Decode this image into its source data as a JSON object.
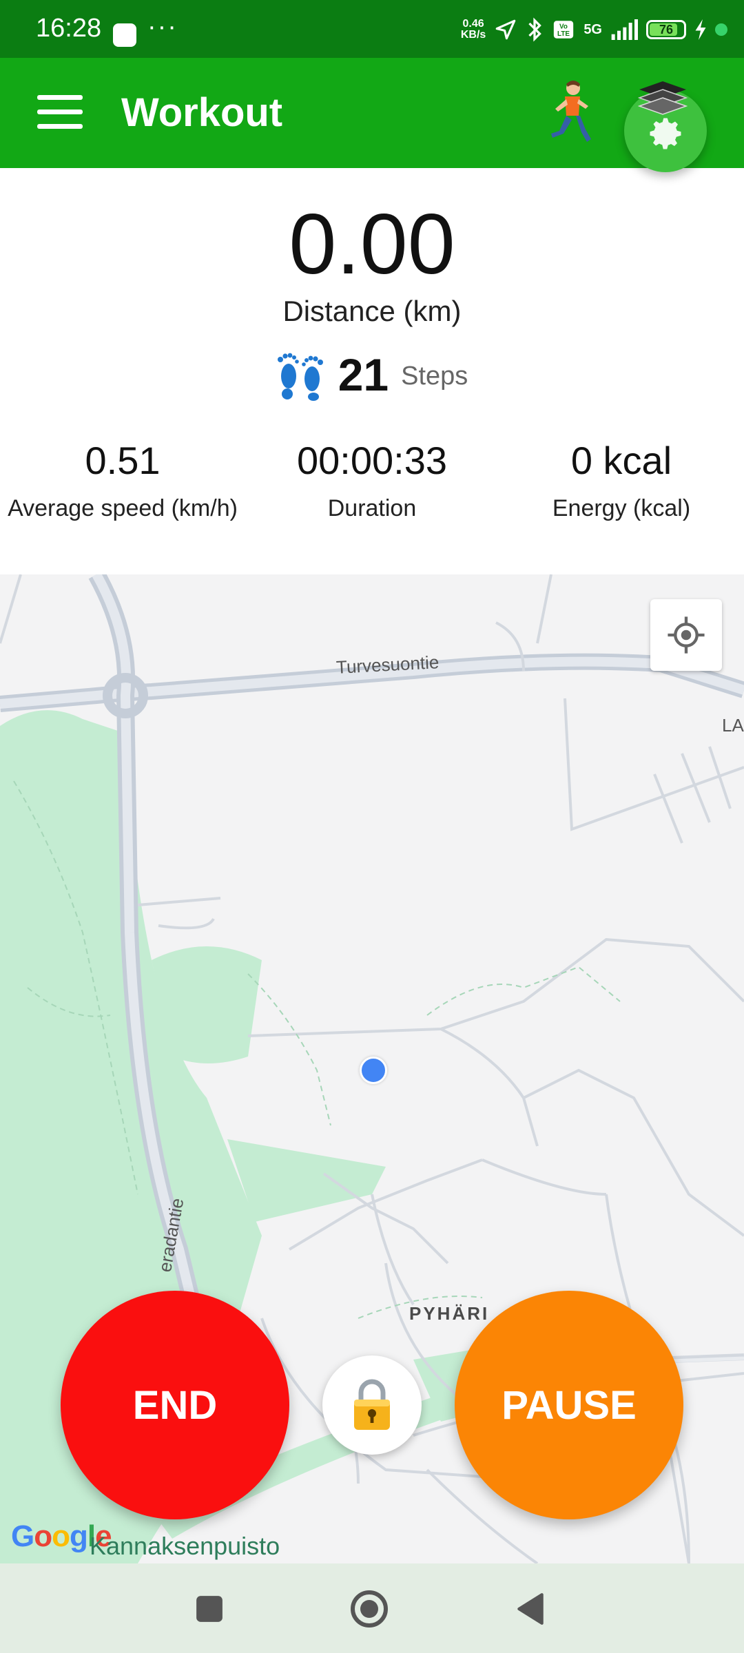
{
  "status_bar": {
    "time": "16:28",
    "more": "···",
    "net_speed_value": "0.46",
    "net_speed_unit": "KB/s",
    "network": "5G",
    "battery": "76"
  },
  "app_bar": {
    "title": "Workout",
    "color": "#12a815"
  },
  "stats": {
    "distance_value": "0.00",
    "distance_label": "Distance (km)",
    "steps_count": "21",
    "steps_label": "Steps",
    "metrics": [
      {
        "value": "0.51",
        "label": "Average speed (km/h)"
      },
      {
        "value": "00:00:33",
        "label": "Duration"
      },
      {
        "value": "0 kcal",
        "label": "Energy (kcal)"
      }
    ]
  },
  "map": {
    "labels": {
      "road_top": "Turvesuontie",
      "edge": "LA",
      "road_vertical": "eradantie",
      "district": "PYHÄRI"
    },
    "attribution": "Kannaksenpuisto",
    "logo": {
      "G": "G",
      "o1": "o",
      "o2": "o",
      "g": "g",
      "l": "l",
      "e": "e"
    }
  },
  "controls": {
    "end_label": "END",
    "pause_label": "PAUSE",
    "end_color": "#fa0f0f",
    "pause_color": "#fb8505"
  },
  "icons": {
    "menu": "hamburger-icon",
    "runner": "runner-icon",
    "settings": "gear-icon",
    "layers": "layers-icon",
    "footprints": "footprints-icon",
    "locate": "crosshair-icon",
    "lock": "lock-icon"
  }
}
